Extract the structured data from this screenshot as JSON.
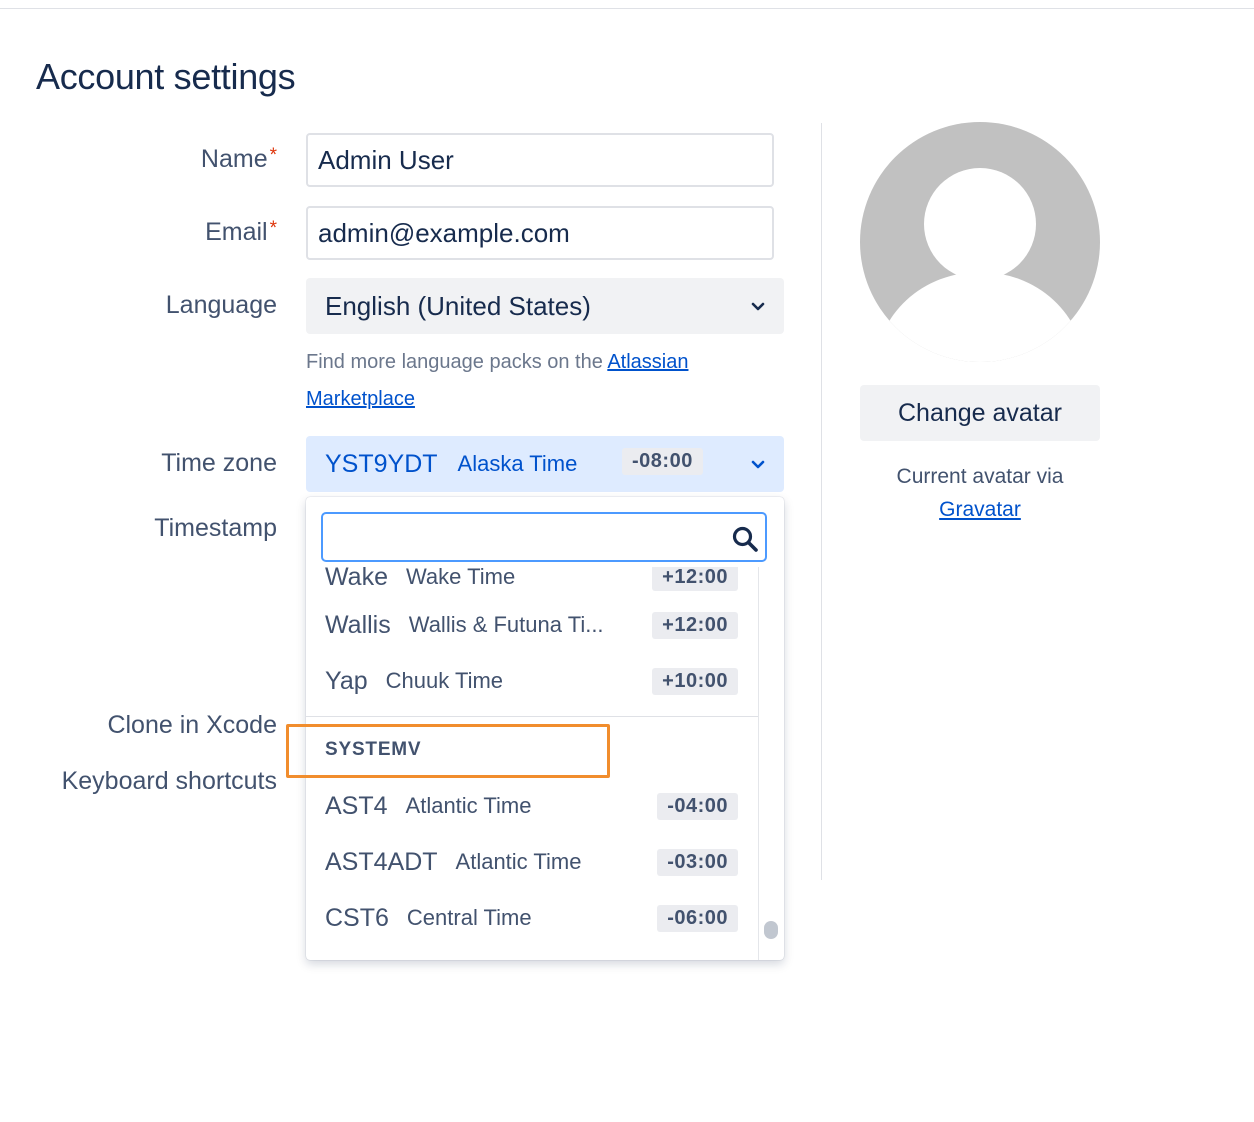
{
  "page": {
    "title": "Account settings"
  },
  "form": {
    "name": {
      "label": "Name",
      "required": "*",
      "value": "Admin User"
    },
    "email": {
      "label": "Email",
      "required": "*",
      "value": "admin@example.com"
    },
    "language": {
      "label": "Language",
      "value": "English (United States)",
      "hint_text": "Find more language packs on the ",
      "hint_link": "Atlassian Marketplace"
    },
    "time_zone": {
      "label": "Time zone",
      "code": "YST9YDT",
      "name": "Alaska Time",
      "offset": "-08:00"
    },
    "timestamp": {
      "label": "Timestamp"
    },
    "clone_in_xcode": {
      "label": "Clone in Xcode"
    },
    "keyboard_shortcuts": {
      "label": "Keyboard shortcuts"
    }
  },
  "tz_dropdown": {
    "search": {
      "value": "",
      "placeholder": ""
    },
    "partial_item": {
      "code": "Wake",
      "name": "Wake Time",
      "offset": "+12:00"
    },
    "items": [
      {
        "code": "Wallis",
        "name": "Wallis & Futuna Ti...",
        "offset": "+12:00"
      },
      {
        "code": "Yap",
        "name": "Chuuk Time",
        "offset": "+10:00"
      }
    ],
    "group_heading": "SYSTEMV",
    "group_items": [
      {
        "code": "AST4",
        "name": "Atlantic Time",
        "offset": "-04:00"
      },
      {
        "code": "AST4ADT",
        "name": "Atlantic Time",
        "offset": "-03:00"
      },
      {
        "code": "CST6",
        "name": "Central Time",
        "offset": "-06:00"
      }
    ]
  },
  "avatar": {
    "button_label": "Change avatar",
    "note_text": "Current avatar via",
    "note_link": "Gravatar"
  },
  "colors": {
    "highlight_box": "#f18d2d",
    "link": "#0052cc",
    "required_star": "#de350b",
    "avatar_grey": "#c1c1c1"
  }
}
